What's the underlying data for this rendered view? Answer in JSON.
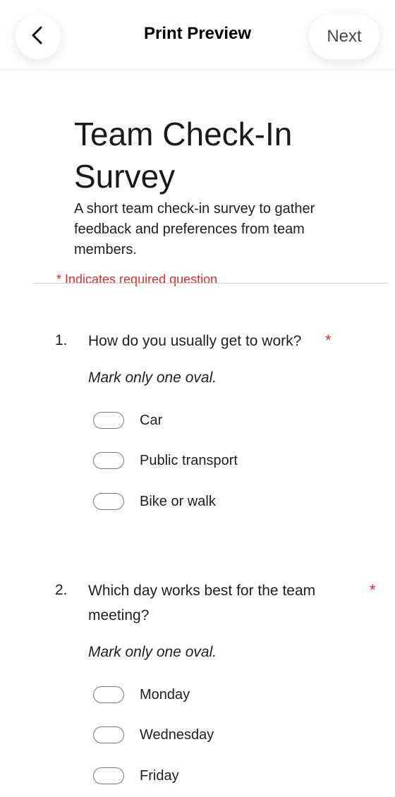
{
  "topbar": {
    "title": "Print Preview",
    "next_label": "Next",
    "back_icon": "chevron-left-icon"
  },
  "form": {
    "title": "Team Check-In Survey",
    "description": "A short team check-in survey to gather feedback and preferences from team members.",
    "required_note": "* Indicates required question"
  },
  "questions": [
    {
      "number": "1.",
      "text": "How do you usually get to work?",
      "required_mark": "*",
      "hint": "Mark only one oval.",
      "options": [
        "Car",
        "Public transport",
        "Bike or walk"
      ]
    },
    {
      "number": "2.",
      "text": "Which day works best for the team meeting?",
      "required_mark": "*",
      "hint": "Mark only one oval.",
      "options": [
        "Monday",
        "Wednesday",
        "Friday"
      ]
    }
  ],
  "colors": {
    "required": "#d93025",
    "text": "#1f1f1f",
    "oval_border": "#7a7a7a"
  }
}
